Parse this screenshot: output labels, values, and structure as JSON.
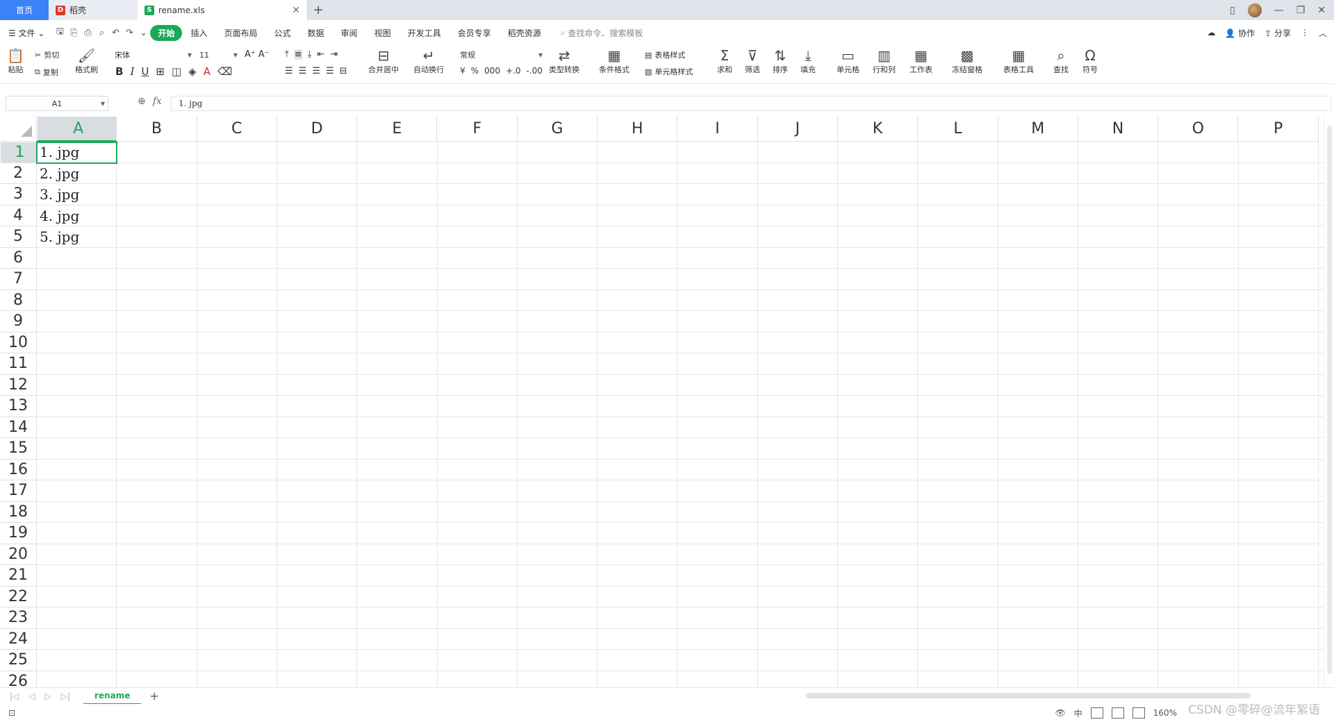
{
  "tabs": {
    "home": "首页",
    "docer": "稻壳",
    "file": "rename.xls"
  },
  "menu": {
    "file": "文件",
    "items": [
      "开始",
      "插入",
      "页面布局",
      "公式",
      "数据",
      "审阅",
      "视图",
      "开发工具",
      "会员专享",
      "稻壳资源"
    ],
    "search_placeholder": "查找命令、搜索模板",
    "collab": "协作",
    "share": "分享"
  },
  "ribbon": {
    "paste": "粘贴",
    "cut": "剪切",
    "copy": "复制",
    "format_painter": "格式刷",
    "font_name": "宋体",
    "font_size": "11",
    "merge_center": "合并居中",
    "wrap": "自动换行",
    "number_format": "常规",
    "type_convert": "类型转换",
    "cond_format": "条件格式",
    "table_style": "表格样式",
    "cell_style": "单元格样式",
    "sum": "求和",
    "filter": "筛选",
    "sort": "排序",
    "fill": "填充",
    "cells": "单元格",
    "rows_cols": "行和列",
    "worksheet": "工作表",
    "freeze": "冻结窗格",
    "table_tools": "表格工具",
    "find": "查找",
    "symbol": "符号"
  },
  "formula_bar": {
    "name_box": "A1",
    "fx": "fx",
    "content": "1. jpg"
  },
  "columns": [
    "A",
    "B",
    "C",
    "D",
    "E",
    "F",
    "G",
    "H",
    "I",
    "J",
    "K",
    "L",
    "M",
    "N",
    "O",
    "P"
  ],
  "rows": [
    "1",
    "2",
    "3",
    "4",
    "5",
    "6",
    "7",
    "8",
    "9",
    "10",
    "11",
    "12",
    "13",
    "14",
    "15",
    "16",
    "17",
    "18",
    "19",
    "20",
    "21",
    "22",
    "23",
    "24",
    "25",
    "26"
  ],
  "cells": [
    "1. jpg",
    "2. jpg",
    "3. jpg",
    "4. jpg",
    "5. jpg"
  ],
  "sheet": {
    "name": "rename"
  },
  "status": {
    "zoom": "160%"
  },
  "watermark": "CSDN @零碎@流年絮语"
}
